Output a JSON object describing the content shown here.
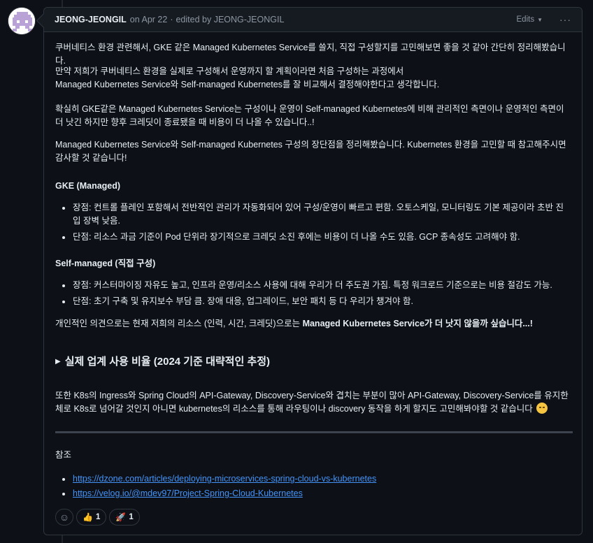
{
  "header": {
    "author": "JEONG-JEONGIL",
    "date_text": "on Apr 22",
    "edited_text": "edited by JEONG-JEONGIL",
    "edits_label": "Edits",
    "more_label": "···"
  },
  "body": {
    "p1": "쿠버네티스 환경 관련해서, GKE 같은 Managed Kubernetes Service를 쓸지, 직접 구성할지를 고민해보면 좋을 것 같아 간단히 정리해봤습니다.",
    "p2_line1": "만약 저희가 쿠버네티스 환경을 실제로 구성해서 운영까지 할 계획이라면 처음 구성하는 과정에서",
    "p2_line2": "Managed Kubernetes Service와 Self-managed Kubernetes를 잘 비교해서 결정해야한다고 생각합니다.",
    "p3": "확실히 GKE같은 Managed Kubernetes Service는 구성이나 운영이 Self-managed Kubernetes에 비해 관리적인 측면이나 운영적인 측면이 더 낫긴 하지만 향후 크레딧이 종료됐을 때 비용이 더 나올 수 있습니다..!",
    "p4": "Managed Kubernetes Service와 Self-managed Kubernetes 구성의 장단점을 정리해봤습니다. Kubernetes 환경을 고민할 때 참고해주시면 감사할 것 같습니다!",
    "gke_heading": "GKE (Managed)",
    "gke_items": [
      "장점: 컨트롤 플레인 포함해서 전반적인 관리가 자동화되어 있어 구성/운영이 빠르고 편함. 오토스케일, 모니터링도 기본 제공이라 초반 진입 장벽 낮음.",
      "단점: 리소스 과금 기준이 Pod 단위라 장기적으로 크레딧 소진 후에는 비용이 더 나올 수도 있음. GCP 종속성도 고려해야 함."
    ],
    "self_heading": "Self-managed (직접 구성)",
    "self_items": [
      "장점: 커스터마이징 자유도 높고, 인프라 운영/리소스 사용에 대해 우리가 더 주도권 가짐. 특정 워크로드 기준으로는 비용 절감도 가능.",
      "단점: 초기 구축 및 유지보수 부담 큼. 장애 대응, 업그레이드, 보안 패치 등 다 우리가 챙겨야 함."
    ],
    "p5_prefix": "개인적인 의견으로는 현재 저희의 리소스 (인력, 시간, 크레딧)으로는 ",
    "p5_bold": "Managed Kubernetes Service가 더 낫지 않을까 싶습니다...!",
    "details_summary": "실제 업계 사용 비율 (2024 기준 대략적인 추정)",
    "p6": "또한 K8s의 Ingress와 Spring Cloud의 API-Gateway, Discovery-Service와 겹치는 부분이 많아 API-Gateway, Discovery-Service를 유지한체로 K8s로 넘어갈 것인지 아니면 kubernetes의 리소스를 통해 라우팅이나 discovery 동작을 하게 할지도 고민해봐야할 것 같습니다",
    "ref_title": "참조",
    "links": [
      "https://dzone.com/articles/deploying-microservices-spring-cloud-vs-kubernetes",
      "https://velog.io/@mdev97/Project-Spring-Cloud-Kubernetes"
    ]
  },
  "reactions": [
    {
      "icon": "thumbs-up",
      "glyph": "👍",
      "count": "1"
    },
    {
      "icon": "rocket",
      "glyph": "🚀",
      "count": "1"
    }
  ],
  "colors": {
    "background": "#0d1117",
    "border": "#30363d",
    "header_bg": "#161b22",
    "link": "#4493f8",
    "text": "#e6edf3",
    "muted": "#8d96a0"
  }
}
